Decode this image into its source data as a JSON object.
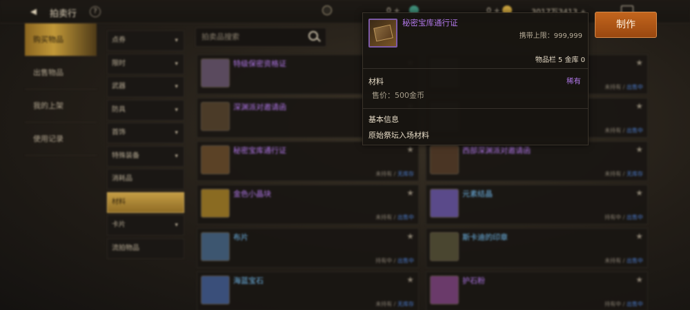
{
  "header": {
    "title": "拍卖行",
    "help": "?",
    "currency1": "0 +",
    "currency2": "0 +",
    "user": "3017万3413 +",
    "craft_button": "制作"
  },
  "leftnav": [
    {
      "label": "购买物品",
      "active": true
    },
    {
      "label": "出售物品",
      "active": false
    },
    {
      "label": "我的上架",
      "active": false
    },
    {
      "label": "使用记录",
      "active": false
    }
  ],
  "categories": [
    {
      "label": "点券",
      "chevron": "▾"
    },
    {
      "label": "限时",
      "chevron": "▾"
    },
    {
      "label": "武器",
      "chevron": "▾"
    },
    {
      "label": "防具",
      "chevron": "▾"
    },
    {
      "label": "首饰",
      "chevron": "▾"
    },
    {
      "label": "特殊装备",
      "chevron": "▾"
    },
    {
      "label": "消耗品",
      "chevron": ""
    },
    {
      "label": "材料",
      "chevron": "",
      "active": true
    },
    {
      "label": "卡片",
      "chevron": "▾"
    },
    {
      "label": "流拍物品",
      "chevron": ""
    }
  ],
  "search": {
    "placeholder": "拍卖品搜索"
  },
  "items_left": [
    {
      "name": "特级保密资格证",
      "color": "#b077e8",
      "status_a": "",
      "status_b": ""
    },
    {
      "name": "深渊派对邀请函",
      "color": "#b077e8",
      "status_a": "",
      "status_b": ""
    },
    {
      "name": "秘密宝库通行证",
      "color": "#b077e8",
      "status_a": "未持有",
      "status_b": "无库存"
    },
    {
      "name": "金色小晶块",
      "color": "#b077e8",
      "status_a": "未持有",
      "status_b": "出售中"
    },
    {
      "name": "布片",
      "color": "#6fb6e8",
      "status_a": "持有中",
      "status_b": "出售中"
    },
    {
      "name": "海蓝宝石",
      "color": "#6fb6e8",
      "status_a": "未持有",
      "status_b": "无库存"
    }
  ],
  "items_right": [
    {
      "name": "",
      "color": "#b077e8",
      "status_a": "未持有",
      "status_b": "出售中"
    },
    {
      "name": "",
      "color": "#b077e8",
      "status_a": "未持有",
      "status_b": "出售中"
    },
    {
      "name": "西部深渊派对邀请函",
      "color": "#b077e8",
      "status_a": "未持有",
      "status_b": "无库存"
    },
    {
      "name": "元素结晶",
      "color": "#6fb6e8",
      "status_a": "持有中",
      "status_b": "出售中"
    },
    {
      "name": "斯卡迪的印章",
      "color": "#6fb6e8",
      "status_a": "未持有",
      "status_b": "出售中"
    },
    {
      "name": "护石粉",
      "color": "#b077e8",
      "status_a": "持有中",
      "status_b": "出售中"
    }
  ],
  "popup": {
    "name": "秘密宝库通行证",
    "limit": "携带上限：999,999",
    "stock": "物品栏 5 金库 0",
    "type": "材料",
    "rarity": "稀有",
    "price": "售价：500金币",
    "basic_title": "基本信息",
    "description": "原始祭坛入场材料"
  }
}
